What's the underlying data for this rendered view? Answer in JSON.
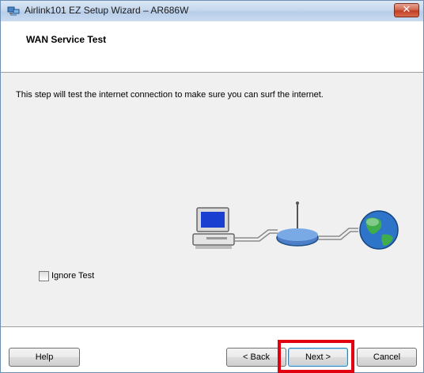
{
  "window": {
    "title": "Airlink101 EZ Setup Wizard – AR686W",
    "close_glyph": "✕"
  },
  "header": {
    "title": "WAN Service Test"
  },
  "body": {
    "description": "This step will test the internet connection to make sure you can surf the internet.",
    "illustration_icons": [
      "computer-icon",
      "router-icon",
      "globe-icon"
    ],
    "ignore_test": {
      "label": "Ignore Test",
      "checked": false
    }
  },
  "footer": {
    "help_label": "Help",
    "back_label": "< Back",
    "next_label": "Next >",
    "cancel_label": "Cancel"
  },
  "colors": {
    "highlight": "#e0000f",
    "close_button": "#c23f24",
    "titlebar": "#c6d8ee",
    "panel": "#f0f0f0"
  }
}
